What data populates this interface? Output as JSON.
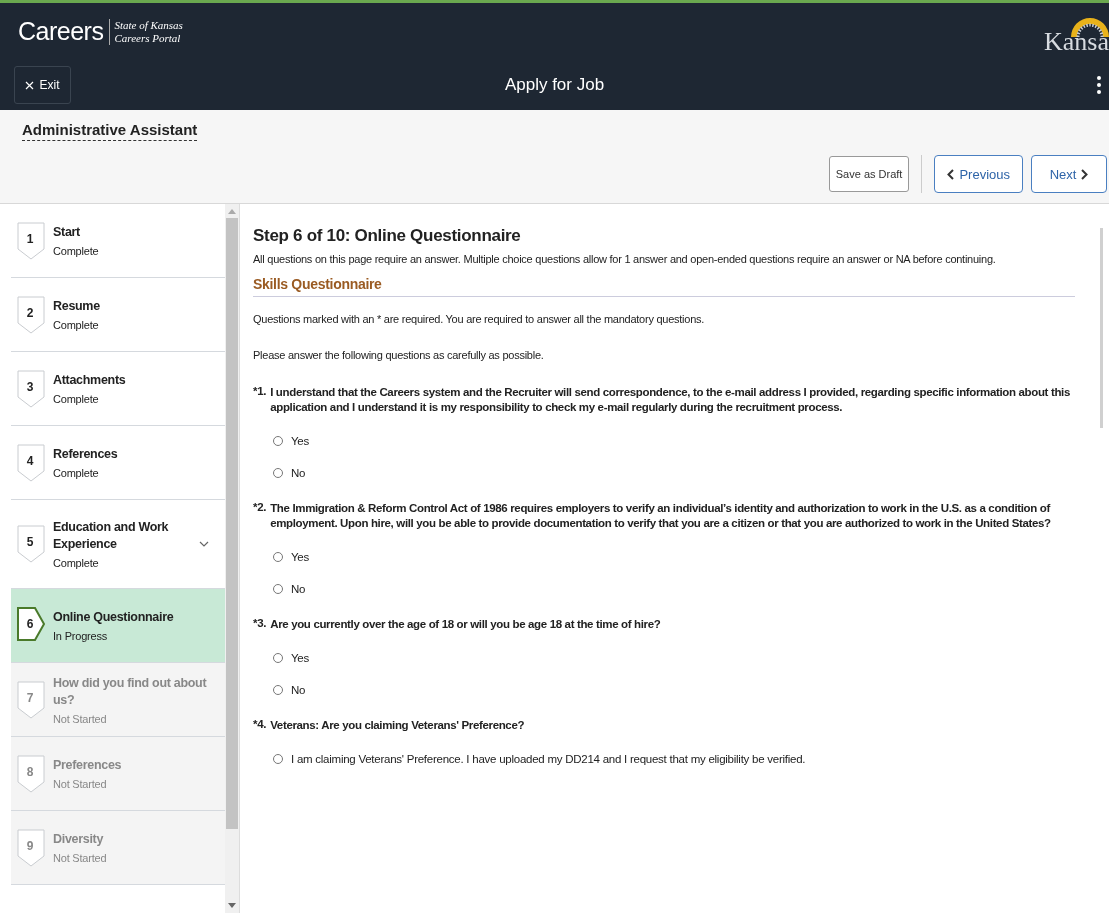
{
  "header": {
    "brand": "Careers",
    "subtitle_line1": "State of Kansas",
    "subtitle_line2": "Careers Portal",
    "logo_text": "Kansa",
    "exit_label": "Exit",
    "title": "Apply for Job"
  },
  "job": {
    "title": "Administrative Assistant",
    "buttons": [
      {
        "label": "Save as Draft",
        "kind": "plain"
      },
      {
        "label": "Previous",
        "kind": "prev"
      },
      {
        "label": "Next",
        "kind": "next"
      }
    ]
  },
  "steps": [
    {
      "number": "1",
      "title": "Start",
      "status": "Complete",
      "disabled": false,
      "selected": false
    },
    {
      "number": "2",
      "title": "Resume",
      "status": "Complete",
      "disabled": false,
      "selected": false
    },
    {
      "number": "3",
      "title": "Attachments",
      "status": "Complete",
      "disabled": false,
      "selected": false
    },
    {
      "number": "4",
      "title": "References",
      "status": "Complete",
      "disabled": false,
      "selected": false
    },
    {
      "number": "5",
      "title": "Education and Work Experience",
      "status": "Complete",
      "disabled": false,
      "selected": false,
      "expandable": true
    },
    {
      "number": "6",
      "title": "Online Questionnaire",
      "status": "In Progress",
      "disabled": false,
      "selected": true
    },
    {
      "number": "7",
      "title": "How did you find out about us?",
      "status": "Not Started",
      "disabled": true,
      "selected": false
    },
    {
      "number": "8",
      "title": "Preferences",
      "status": "Not Started",
      "disabled": true,
      "selected": false
    },
    {
      "number": "9",
      "title": "Diversity",
      "status": "Not Started",
      "disabled": true,
      "selected": false
    }
  ],
  "main": {
    "heading": "Step 6 of 10: Online Questionnaire",
    "intro": "All questions on this page require an answer. Multiple choice questions allow for 1 answer and open-ended questions require an answer or NA before continuing.",
    "section": "Skills Questionnaire",
    "notes": [
      "Questions marked with an * are required. You are required to answer all the mandatory questions.",
      "Please answer the following questions as carefully as possible."
    ],
    "questions": [
      {
        "number": "*1.",
        "text": "I understand that the Careers system and the Recruiter will send correspondence, to the e-mail address I provided, regarding specific information about this application and I understand it is my responsibility to check my e-mail regularly during the recruitment process.",
        "options": [
          {
            "label": "Yes",
            "selected": false
          },
          {
            "label": "No",
            "selected": false
          }
        ]
      },
      {
        "number": "*2.",
        "text": "The Immigration & Reform Control Act of 1986 requires employers to verify an individual’s identity and authorization to work in the U.S. as a condition of employment. Upon hire, will you be able to provide documentation to verify that you are a citizen or that you are authorized to work in the United States?",
        "options": [
          {
            "label": "Yes",
            "selected": false
          },
          {
            "label": "No",
            "selected": false
          }
        ]
      },
      {
        "number": "*3.",
        "text": "Are you currently over the age of 18 or will you be age 18 at the time of hire?",
        "options": [
          {
            "label": "Yes",
            "selected": false
          },
          {
            "label": "No",
            "selected": false
          }
        ]
      },
      {
        "number": "*4.",
        "text": "Veterans: Are you claiming Veterans' Preference?",
        "options": [
          {
            "label": "I am claiming Veterans' Preference. I have uploaded my DD214 and I request that my eligibility be verified.",
            "selected": false
          }
        ]
      }
    ]
  }
}
